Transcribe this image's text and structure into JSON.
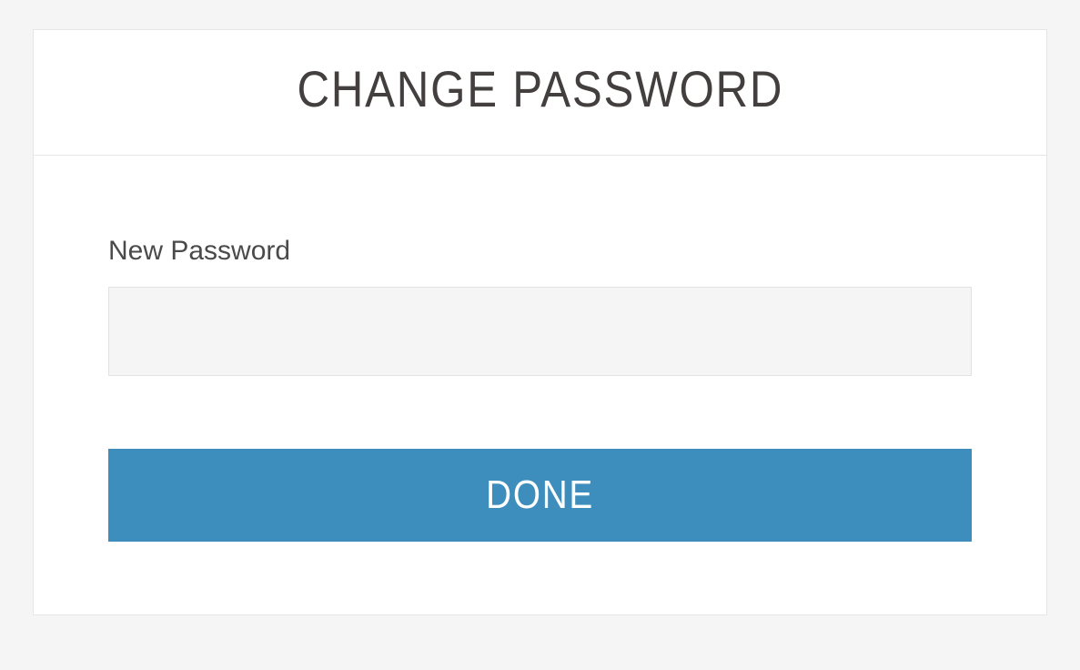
{
  "card": {
    "title": "CHANGE PASSWORD",
    "form": {
      "password_label": "New Password",
      "password_value": "",
      "submit_label": "DONE"
    }
  }
}
